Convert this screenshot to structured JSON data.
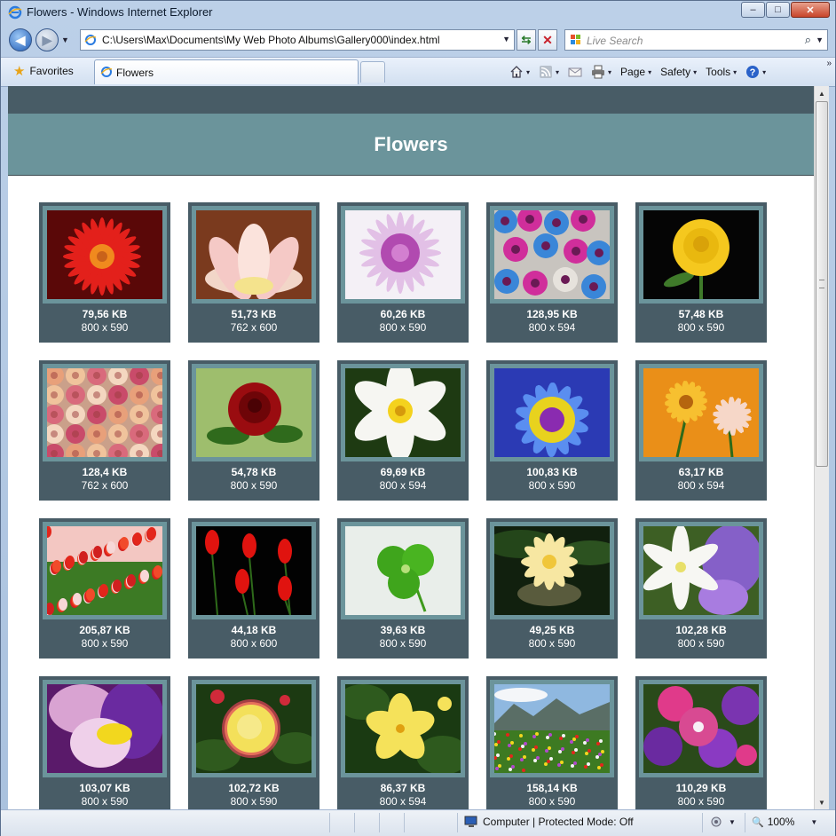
{
  "window": {
    "title": "Flowers - Windows Internet Explorer",
    "minimize_glyph": "–",
    "maximize_glyph": "□",
    "close_glyph": "✕"
  },
  "toolbar": {
    "back_glyph": "◀",
    "forward_glyph": "▶",
    "dropdown_glyph": "▼",
    "address": "C:\\Users\\Max\\Documents\\My Web Photo Albums\\Gallery000\\index.html",
    "refresh_glyph": "⇆",
    "stop_glyph": "✕",
    "search_placeholder": "Live Search",
    "search_glyph": "⌕"
  },
  "tabs": {
    "favorites_label": "Favorites",
    "star_glyph": "★",
    "active_tab": "Flowers"
  },
  "commands": {
    "page": "Page",
    "safety": "Safety",
    "tools": "Tools",
    "help_glyph": "?",
    "caret": "▾",
    "chevron": "»"
  },
  "page": {
    "title": "Flowers",
    "photos": [
      {
        "size": "79,56 KB",
        "dims": "800 x 590"
      },
      {
        "size": "51,73 KB",
        "dims": "762 x 600"
      },
      {
        "size": "60,26 KB",
        "dims": "800 x 590"
      },
      {
        "size": "128,95 KB",
        "dims": "800 x 594"
      },
      {
        "size": "57,48 KB",
        "dims": "800 x 590"
      },
      {
        "size": "128,4 KB",
        "dims": "762 x 600"
      },
      {
        "size": "54,78 KB",
        "dims": "800 x 590"
      },
      {
        "size": "69,69 KB",
        "dims": "800 x 594"
      },
      {
        "size": "100,83 KB",
        "dims": "800 x 590"
      },
      {
        "size": "63,17 KB",
        "dims": "800 x 594"
      },
      {
        "size": "205,87 KB",
        "dims": "800 x 590"
      },
      {
        "size": "44,18 KB",
        "dims": "800 x 600"
      },
      {
        "size": "39,63 KB",
        "dims": "800 x 590"
      },
      {
        "size": "49,25 KB",
        "dims": "800 x 590"
      },
      {
        "size": "102,28 KB",
        "dims": "800 x 590"
      },
      {
        "size": "103,07 KB",
        "dims": "800 x 590"
      },
      {
        "size": "102,72 KB",
        "dims": "800 x 590"
      },
      {
        "size": "86,37 KB",
        "dims": "800 x 594"
      },
      {
        "size": "158,14 KB",
        "dims": "800 x 590"
      },
      {
        "size": "110,29 KB",
        "dims": "800 x 590"
      }
    ]
  },
  "statusbar": {
    "zone": "Computer | Protected Mode: Off",
    "zoom": "100%",
    "zoom_glyph": "🔍",
    "caret": "▼"
  },
  "scrollbar": {
    "up_glyph": "▲",
    "down_glyph": "▼"
  },
  "colors": {
    "header_dark": "#485c66",
    "header_title_band": "#6b949b",
    "card_bg": "#485c66",
    "card_frame": "#6b949b"
  }
}
